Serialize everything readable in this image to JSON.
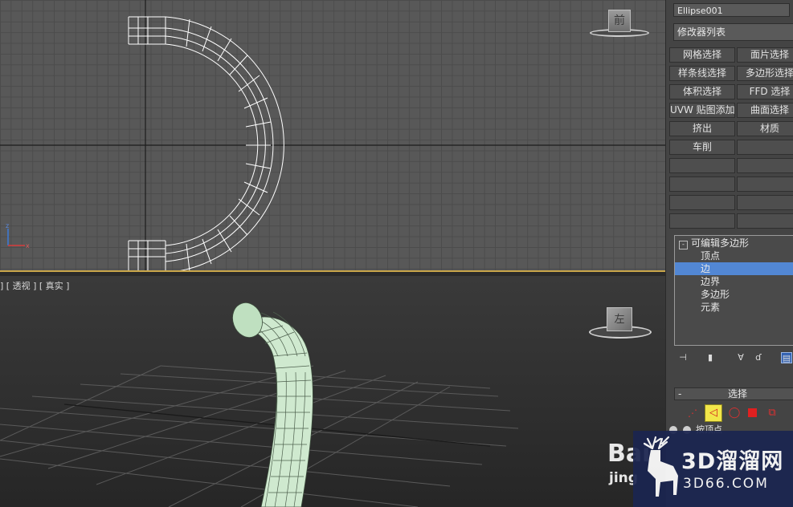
{
  "viewport_top": {
    "viewcube_label": "前"
  },
  "viewport_persp": {
    "label_parts": [
      "]",
      "[",
      "透视",
      "]",
      "[",
      "真实",
      "]"
    ],
    "label": "] [ 透视 ] [ 真实 ]",
    "viewcube_label": "左"
  },
  "panel": {
    "object_name": "Ellipse001",
    "modifier_list": "修改器列表",
    "modifier_buttons": [
      "网格选择",
      "面片选择",
      "样条线选择",
      "多边形选择",
      "体积选择",
      "FFD 选择",
      "UVW 贴图添加",
      "曲面选择",
      "挤出",
      "材质",
      "车削",
      ""
    ],
    "stack": {
      "root": "可编辑多边形",
      "items": [
        "顶点",
        "边",
        "边界",
        "多边形",
        "元素"
      ],
      "selected": "边"
    },
    "rollout_title": "选择",
    "rollout_toggle": "-",
    "partial_checkbox_label": "按顶点"
  },
  "watermark": {
    "brand": "3D溜溜网",
    "url": "3D66.COM"
  },
  "baidu_mark": {
    "top": "Bai",
    "bottom": "jing"
  },
  "colors": {
    "viewport_top_bg": "#585858",
    "active_border": "#c9a64a",
    "stack_selected": "#5287d4",
    "mesh_fill": "#cfe9cf",
    "watermark_bg": "#1b2550"
  }
}
